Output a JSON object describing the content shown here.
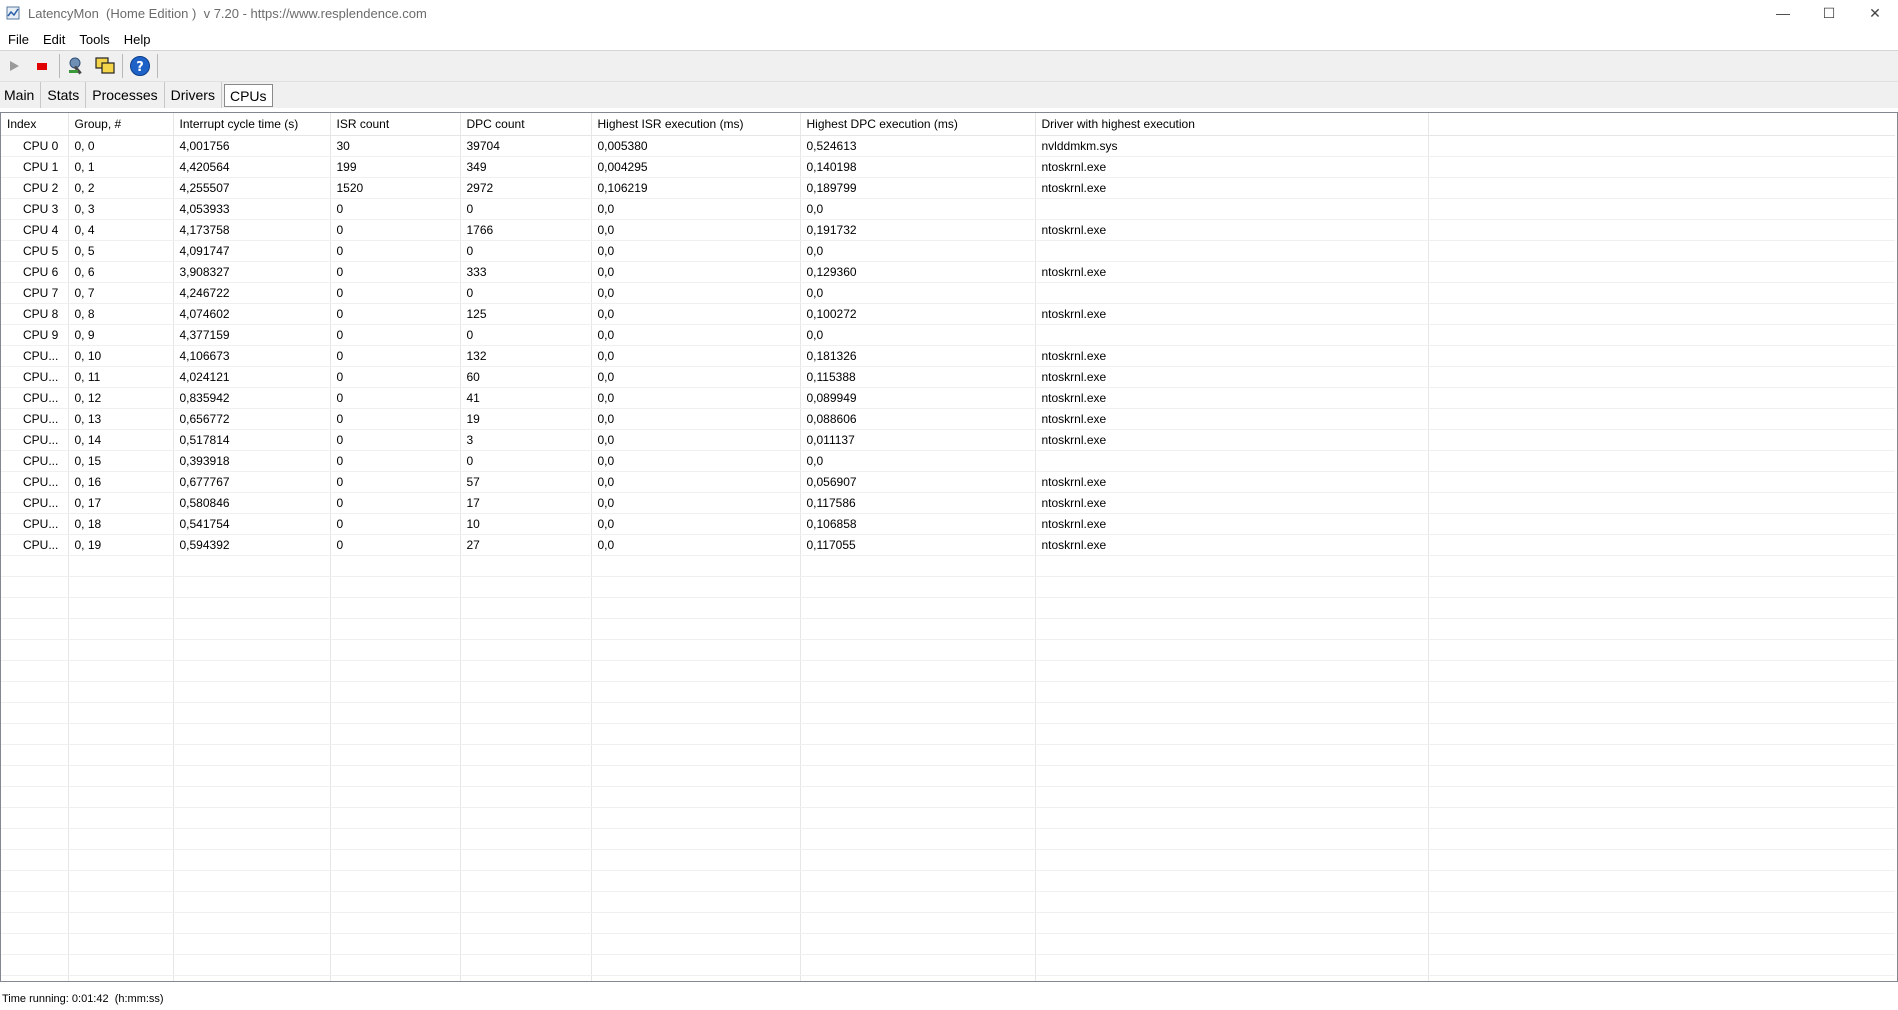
{
  "window": {
    "title": "LatencyMon  (Home Edition )  v 7.20 - https://www.resplendence.com",
    "minimize": "—",
    "maximize": "☐",
    "close": "✕"
  },
  "menu": {
    "file": "File",
    "edit": "Edit",
    "tools": "Tools",
    "help": "Help"
  },
  "toolbar": {
    "icons": [
      "play-icon",
      "stop-icon",
      "tool-icon",
      "windows-icon",
      "help-icon"
    ],
    "stop_color": "#e00000",
    "help_color": "#1e62c8"
  },
  "tabs": [
    "Main",
    "Stats",
    "Processes",
    "Drivers",
    "CPUs"
  ],
  "active_tab": "CPUs",
  "table": {
    "columns": [
      "Index",
      "Group, #",
      "Interrupt cycle time (s)",
      "ISR count",
      "DPC count",
      "Highest ISR execution (ms)",
      "Highest DPC execution (ms)",
      "Driver with highest execution"
    ],
    "rows": [
      [
        "CPU 0",
        "0, 0",
        "4,001756",
        "30",
        "39704",
        "0,005380",
        "0,524613",
        "nvlddmkm.sys"
      ],
      [
        "CPU 1",
        "0, 1",
        "4,420564",
        "199",
        "349",
        "0,004295",
        "0,140198",
        "ntoskrnl.exe"
      ],
      [
        "CPU 2",
        "0, 2",
        "4,255507",
        "1520",
        "2972",
        "0,106219",
        "0,189799",
        "ntoskrnl.exe"
      ],
      [
        "CPU 3",
        "0, 3",
        "4,053933",
        "0",
        "0",
        "0,0",
        "0,0",
        ""
      ],
      [
        "CPU 4",
        "0, 4",
        "4,173758",
        "0",
        "1766",
        "0,0",
        "0,191732",
        "ntoskrnl.exe"
      ],
      [
        "CPU 5",
        "0, 5",
        "4,091747",
        "0",
        "0",
        "0,0",
        "0,0",
        ""
      ],
      [
        "CPU 6",
        "0, 6",
        "3,908327",
        "0",
        "333",
        "0,0",
        "0,129360",
        "ntoskrnl.exe"
      ],
      [
        "CPU 7",
        "0, 7",
        "4,246722",
        "0",
        "0",
        "0,0",
        "0,0",
        ""
      ],
      [
        "CPU 8",
        "0, 8",
        "4,074602",
        "0",
        "125",
        "0,0",
        "0,100272",
        "ntoskrnl.exe"
      ],
      [
        "CPU 9",
        "0, 9",
        "4,377159",
        "0",
        "0",
        "0,0",
        "0,0",
        ""
      ],
      [
        "CPU...",
        "0, 10",
        "4,106673",
        "0",
        "132",
        "0,0",
        "0,181326",
        "ntoskrnl.exe"
      ],
      [
        "CPU...",
        "0, 11",
        "4,024121",
        "0",
        "60",
        "0,0",
        "0,115388",
        "ntoskrnl.exe"
      ],
      [
        "CPU...",
        "0, 12",
        "0,835942",
        "0",
        "41",
        "0,0",
        "0,089949",
        "ntoskrnl.exe"
      ],
      [
        "CPU...",
        "0, 13",
        "0,656772",
        "0",
        "19",
        "0,0",
        "0,088606",
        "ntoskrnl.exe"
      ],
      [
        "CPU...",
        "0, 14",
        "0,517814",
        "0",
        "3",
        "0,0",
        "0,011137",
        "ntoskrnl.exe"
      ],
      [
        "CPU...",
        "0, 15",
        "0,393918",
        "0",
        "0",
        "0,0",
        "0,0",
        ""
      ],
      [
        "CPU...",
        "0, 16",
        "0,677767",
        "0",
        "57",
        "0,0",
        "0,056907",
        "ntoskrnl.exe"
      ],
      [
        "CPU...",
        "0, 17",
        "0,580846",
        "0",
        "17",
        "0,0",
        "0,117586",
        "ntoskrnl.exe"
      ],
      [
        "CPU...",
        "0, 18",
        "0,541754",
        "0",
        "10",
        "0,0",
        "0,106858",
        "ntoskrnl.exe"
      ],
      [
        "CPU...",
        "0, 19",
        "0,594392",
        "0",
        "27",
        "0,0",
        "0,117055",
        "ntoskrnl.exe"
      ]
    ]
  },
  "status": {
    "text": "Time running: 0:01:42  (h:mm:ss)"
  }
}
